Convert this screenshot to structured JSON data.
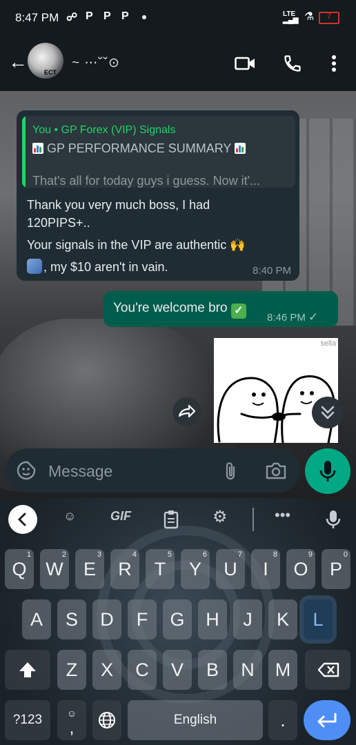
{
  "status_bar": {
    "time": "8:47 PM",
    "notification_icons": [
      "chat-bubbles-icon",
      "p-icon",
      "p-icon",
      "p-icon"
    ],
    "network": "LTE",
    "battery_level": "7"
  },
  "header": {
    "contact_name": "~ ⋯˘˘⊙",
    "avatar_text": "ECT"
  },
  "incoming": {
    "quoted_author": "You • GP Forex (VIP) Signals",
    "quoted_title": "GP PERFORMANCE SUMMARY",
    "quoted_body": "That's all for today guys i guess. Now it'...",
    "lines": [
      "Thank you very much boss, I had",
      "120PIPS+..",
      "Your signals in the VIP are authentic 🙌",
      ", my $10 aren't in vain."
    ],
    "time": "8:40 PM"
  },
  "outgoing": {
    "text": "You're welcome bro",
    "time": "8:46 PM"
  },
  "sticker": {
    "watermark": "sella"
  },
  "input": {
    "placeholder": "Message"
  },
  "keyboard": {
    "tool_gif": "GIF",
    "row1": [
      {
        "k": "Q",
        "h": "1"
      },
      {
        "k": "W",
        "h": "2"
      },
      {
        "k": "E",
        "h": "3"
      },
      {
        "k": "R",
        "h": "4"
      },
      {
        "k": "T",
        "h": "5"
      },
      {
        "k": "Y",
        "h": "6"
      },
      {
        "k": "U",
        "h": "7"
      },
      {
        "k": "I",
        "h": "8"
      },
      {
        "k": "O",
        "h": "9"
      },
      {
        "k": "P",
        "h": "0"
      }
    ],
    "row2": [
      "A",
      "S",
      "D",
      "F",
      "G",
      "H",
      "J",
      "K",
      "L"
    ],
    "row3": [
      "Z",
      "X",
      "C",
      "V",
      "B",
      "N",
      "M"
    ],
    "num_key": "?123",
    "comma_key": ",",
    "space_label": "English",
    "period_key": "."
  }
}
